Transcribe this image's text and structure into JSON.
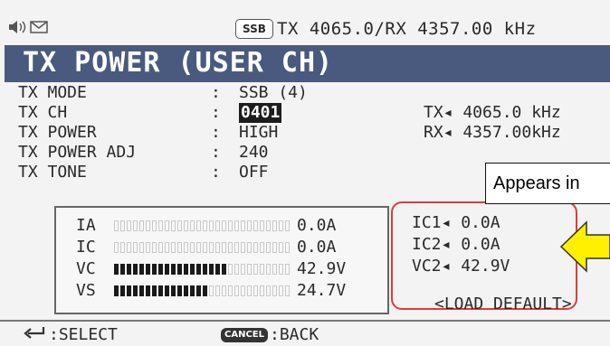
{
  "header": {
    "mode_badge": "SSB",
    "frequency_text": "TX 4065.0/RX 4357.00 kHz"
  },
  "title": "TX POWER (USER CH)",
  "settings": [
    {
      "label": "TX MODE",
      "value": "SSB (4)"
    },
    {
      "label": "TX CH",
      "value": "0401"
    },
    {
      "label": "TX POWER",
      "value": "HIGH"
    },
    {
      "label": "TX POWER ADJ",
      "value": "240"
    },
    {
      "label": "TX TONE",
      "value": "OFF"
    }
  ],
  "colon": ":",
  "tx_freq": "TX◂ 4065.0 kHz",
  "rx_freq": "RX◂ 4357.00kHz",
  "tooltip": "Appears in",
  "meters": [
    {
      "label": "IA",
      "value": "0.0A",
      "level": 0.0
    },
    {
      "label": "IC",
      "value": "0.0A",
      "level": 0.0
    },
    {
      "label": "VC",
      "value": "42.9V",
      "level": 0.64
    },
    {
      "label": "VS",
      "value": "24.7V",
      "level": 0.52
    }
  ],
  "readout": [
    {
      "label": "IC1◂",
      "value": "0.0A"
    },
    {
      "label": "IC2◂",
      "value": "0.0A"
    },
    {
      "label": "VC2◂",
      "value": "42.9V"
    }
  ],
  "load_default": "<LOAD DEFAULT>",
  "footer": {
    "select_label": ":SELECT",
    "cancel_badge": "CANCEL",
    "back_label": ":BACK"
  },
  "colors": {
    "title_band": "#4a5a7e",
    "highlight_box": "#e03a3a",
    "arrow_fill": "#ffef00"
  },
  "icons": [
    "speaker-icon",
    "mail-icon",
    "enter-key-icon",
    "left-arrow-icon"
  ]
}
